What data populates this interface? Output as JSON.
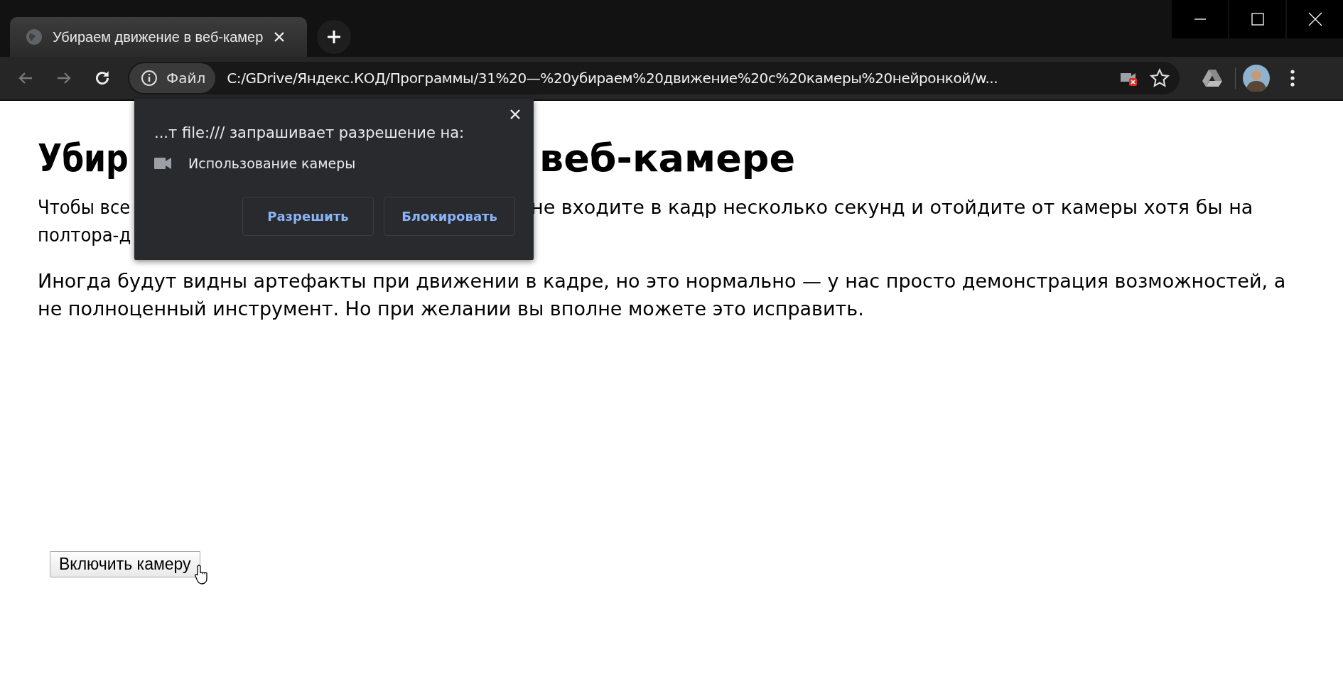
{
  "browser": {
    "tabs": [
      {
        "title": "Убираем движение в веб-камер",
        "selected": true
      }
    ],
    "address_bar": {
      "scheme_label": "Файл",
      "url": "C:/GDrive/Яндекс.КОД/Программы/31%20—%20убираем%20движение%20с%20камеры%20нейронкой/w..."
    }
  },
  "page": {
    "heading_parts": [
      "Убир",
      "веб-камере"
    ],
    "paragraphs": [
      {
        "lines": [
          [
            "Чтобы все",
            "не входите в кадр несколько секунд и отойдите от камеры хотя бы на"
          ],
          [
            "полтора-д"
          ]
        ]
      },
      {
        "text": "Иногда будут видны артефакты при движении в кадре, но это нормально — у нас просто демонстрация возможностей, а не полноценный инструмент. Но при желании вы вполне можете это исправить."
      }
    ],
    "button": "Включить камеру"
  },
  "permission_popup": {
    "title": "...т file:/// запрашивает разрешение на:",
    "permission": "Использование камеры",
    "buttons": [
      "Разрешить",
      "Блокировать"
    ]
  }
}
